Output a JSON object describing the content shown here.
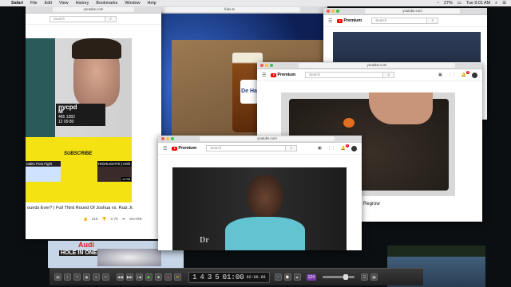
{
  "menubar": {
    "items": [
      "Safari",
      "File",
      "Edit",
      "View",
      "History",
      "Bookmarks",
      "Window",
      "Help"
    ],
    "battery": "27%",
    "clock": "Tue 9:01 AM"
  },
  "windows": {
    "w1": {
      "url": "youtube.com",
      "search": "Search",
      "placard_1": "nycpd",
      "placard_2": "M",
      "placard_3": "465 1382",
      "placard_4": "12 09 80",
      "subscribe": "SUBSCRIBE",
      "thumb_a": "nales Post Fight",
      "thumb_b": "HIGHLIGHTS | Anth",
      "thumb_time": "12:58",
      "title": "ounds Ever? | Full Third Round Of Joshua vs. Ruiz Jr.",
      "likes": "41K",
      "dislikes": "2.7K",
      "share": "SHARE"
    },
    "w2": {
      "url": "fubo.tv",
      "logo_part": "FO",
      "mug_text": "De Ha"
    },
    "w3": {
      "url": "youtube.com",
      "brand": "Premium",
      "search": "Search"
    },
    "w4": {
      "url": "youtube.com",
      "brand": "Premium",
      "search": "Search",
      "badge": "9",
      "caption": "n Regrow"
    },
    "w5": {
      "url": "youtube.com",
      "brand": "Premium",
      "search": "Search",
      "badge": "9",
      "watermark": "Dr"
    },
    "bottom_left": {
      "brand": "Audi",
      "banner": "HOLE IN ONE"
    }
  },
  "controlbar": {
    "track": "1",
    "bar": "4",
    "beat": "3",
    "sub": "5",
    "time": "01:00",
    "time_small": "02:06.66",
    "num": "124"
  }
}
